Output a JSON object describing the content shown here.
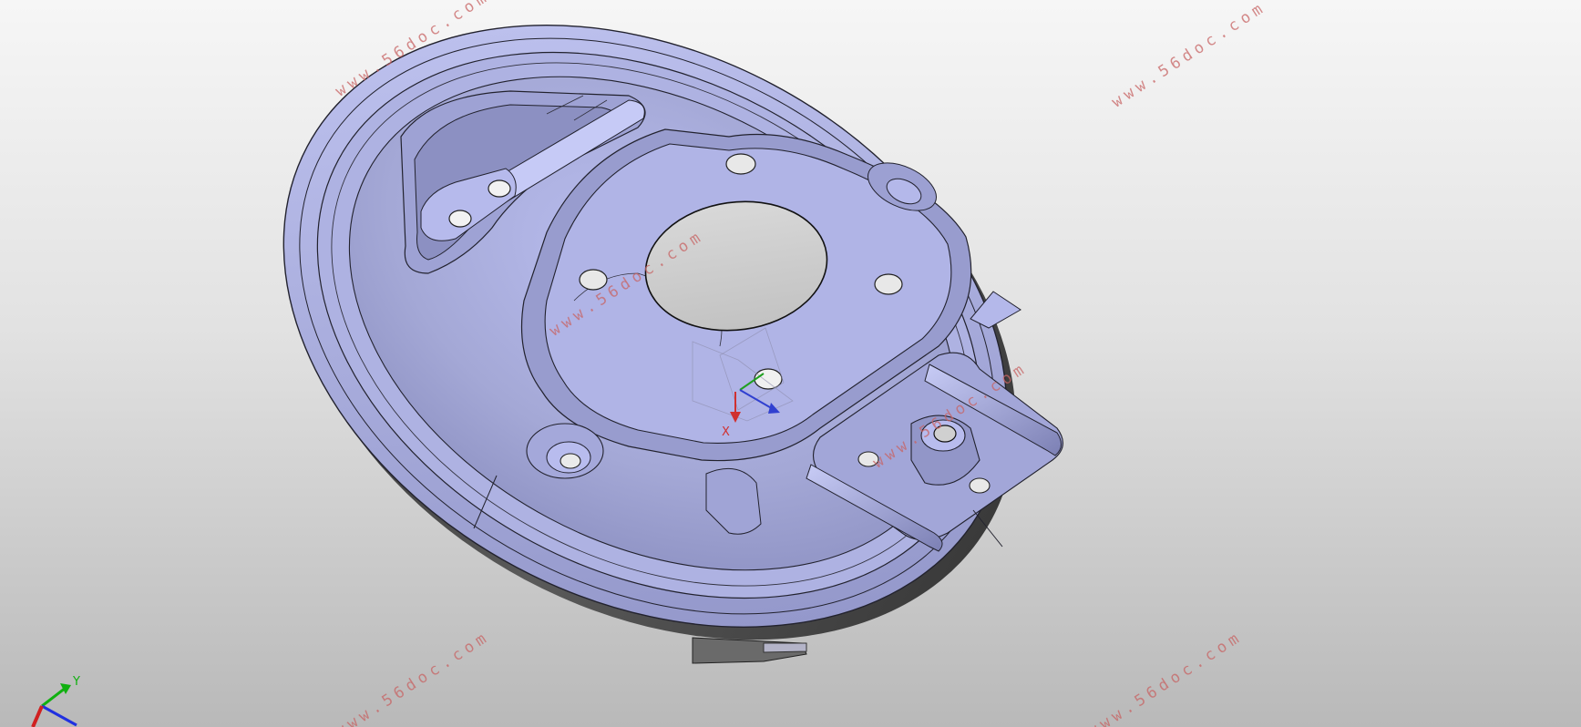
{
  "viewport": {
    "background_top": "#f6f6f6",
    "background_bottom": "#b9b9b9",
    "model_color": "#a8acd8",
    "edge_color": "#2a2a3a"
  },
  "watermarks": [
    "www.56doc.com",
    "www.56doc.com",
    "www.56doc.com",
    "www.56doc.com",
    "www.56doc.com",
    "www.56doc.com"
  ],
  "local_triad": {
    "x_label": "X",
    "x_color": "#d03030",
    "y_color": "#20a020",
    "z_color": "#3040d0"
  },
  "global_triad": {
    "y_label": "Y",
    "x_color": "#d02020",
    "y_color": "#10b010",
    "z_color": "#2030e0"
  }
}
